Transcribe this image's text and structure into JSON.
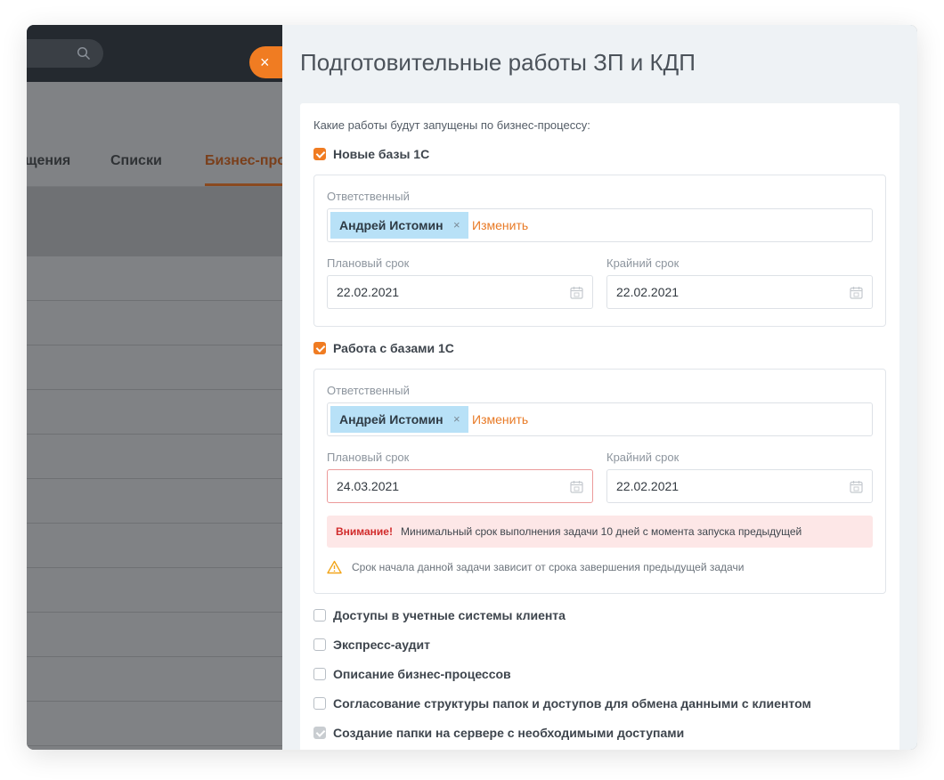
{
  "background": {
    "tabs": [
      "щения",
      "Списки",
      "Бизнес-про"
    ]
  },
  "panel": {
    "close_glyph": "×",
    "title": "Подготовительные работы ЗП и КДП",
    "intro": "Какие работы будут запущены по бизнес-процессу:",
    "tasks": [
      {
        "label": "Новые базы 1С",
        "checked": true,
        "responsible_label": "Ответственный",
        "responsible": "Андрей Истомин",
        "remove_glyph": "×",
        "change_label": "Изменить",
        "planned_label": "Плановый срок",
        "planned_value": "22.02.2021",
        "deadline_label": "Крайний срок",
        "deadline_value": "22.02.2021"
      },
      {
        "label": "Работа с базами 1С",
        "checked": true,
        "responsible_label": "Ответственный",
        "responsible": "Андрей Истомин",
        "remove_glyph": "×",
        "change_label": "Изменить",
        "planned_label": "Плановый срок",
        "planned_value": "24.03.2021",
        "deadline_label": "Крайний срок",
        "deadline_value": "22.02.2021",
        "warning_title": "Внимание!",
        "warning_text": "Минимальный срок выполнения задачи 10 дней с момента запуска предыдущей",
        "hint_text": "Срок начала данной задачи зависит от срока завершения предыдущей задачи"
      }
    ],
    "other_tasks": [
      {
        "label": "Доступы в учетные системы клиента",
        "checked": false
      },
      {
        "label": "Экспресс-аудит",
        "checked": false
      },
      {
        "label": "Описание бизнес-процессов",
        "checked": false
      },
      {
        "label": "Согласование структуры папок и доступов для обмена данными с клиентом",
        "checked": false
      },
      {
        "label": "Создание папки на сервере с необходимыми доступами",
        "checked": true,
        "disabled": true
      }
    ]
  },
  "colors": {
    "accent": "#f07c22",
    "chip": "#b8e1f7",
    "error_bg": "#fde7e7",
    "error_text": "#d12b2b"
  }
}
